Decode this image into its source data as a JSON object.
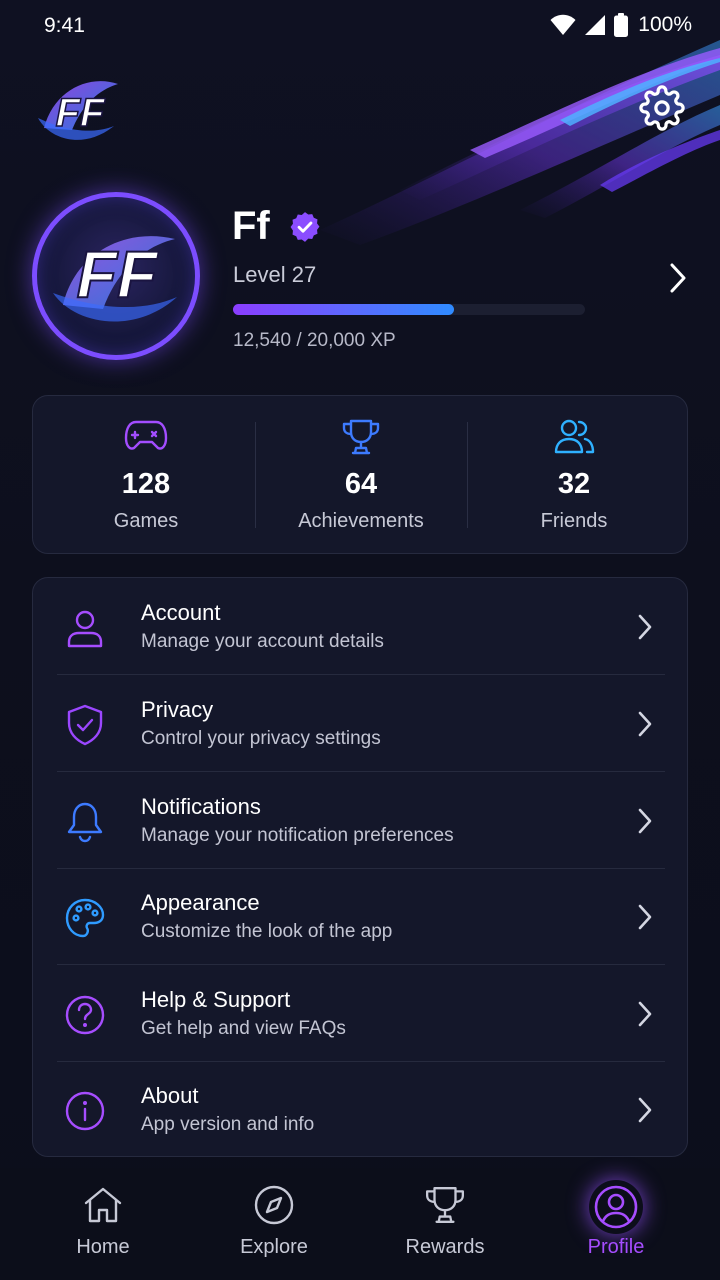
{
  "status_bar": {
    "time": "9:41",
    "battery": "100%",
    "icons": [
      "wifi-icon",
      "cellular-signal-icon",
      "battery-icon"
    ]
  },
  "header": {
    "logo_text": "FF",
    "settings_icon": "gear-icon"
  },
  "profile": {
    "name": "Ff",
    "level": "Level 27",
    "xp_text": "12,540 / 20,000 XP",
    "xp_progress": 0.627,
    "verified": true
  },
  "stats": [
    {
      "icon": "gamepad-icon",
      "value": "128",
      "label": "Games",
      "color": "#a34dff"
    },
    {
      "icon": "trophy-icon",
      "value": "64",
      "label": "Achievements",
      "color": "#3d7bff"
    },
    {
      "icon": "users-icon",
      "value": "32",
      "label": "Friends",
      "color": "#2fb1ff"
    }
  ],
  "menu": [
    {
      "icon": "user-icon",
      "title": "Account",
      "subtitle": "Manage your account details",
      "color": "#a64dff"
    },
    {
      "icon": "shield-check-icon",
      "title": "Privacy",
      "subtitle": "Control your privacy settings",
      "color": "#9b47ff"
    },
    {
      "icon": "bell-icon",
      "title": "Notifications",
      "subtitle": "Manage your notification preferences",
      "color": "#3d7bff"
    },
    {
      "icon": "palette-icon",
      "title": "Appearance",
      "subtitle": "Customize the look of the app",
      "color": "#2f9bff"
    },
    {
      "icon": "help-circle-icon",
      "title": "Help & Support",
      "subtitle": "Get help and view FAQs",
      "color": "#a64dff"
    },
    {
      "icon": "info-circle-icon",
      "title": "About",
      "subtitle": "App version and info",
      "color": "#a64dff"
    }
  ],
  "bottom_nav": [
    {
      "icon": "home-icon",
      "label": "Home",
      "active": false
    },
    {
      "icon": "compass-icon",
      "label": "Explore",
      "active": false
    },
    {
      "icon": "trophy-icon",
      "label": "Rewards",
      "active": false
    },
    {
      "icon": "profile-icon",
      "label": "Profile",
      "active": true
    }
  ],
  "colors": {
    "accent_purple": "#a64dff",
    "accent_blue": "#3d7bff",
    "card_bg": "#14172a",
    "page_bg": "#0e1020"
  }
}
